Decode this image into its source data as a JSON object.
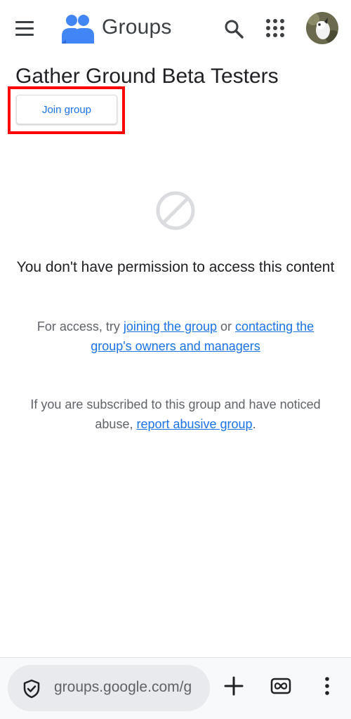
{
  "header": {
    "app_name": "Groups",
    "menu_icon": "hamburger-menu-icon",
    "logo_icon": "google-groups-logo",
    "search_icon": "search-icon",
    "apps_icon": "apps-grid-icon",
    "avatar": "user-avatar"
  },
  "group": {
    "name": "Gather Ground Beta Testers",
    "join_label": "Join group"
  },
  "message": {
    "icon": "blocked-icon",
    "title": "You don't have permission to access this content",
    "access_prefix": "For access, try ",
    "join_link": "joining the group",
    "access_middle": " or ",
    "contact_link": "contacting the group's owners and managers",
    "abuse_prefix": "If you are subscribed to this group and have noticed abuse, ",
    "report_link": "report abusive group",
    "abuse_suffix": "."
  },
  "browser": {
    "url": "groups.google.com/g",
    "security_icon": "shield-check-icon",
    "new_tab_icon": "plus-icon",
    "tabs_icon": "tab-switcher-icon",
    "menu_icon": "more-vert-icon"
  },
  "colors": {
    "accent": "#1a73e8",
    "highlight": "#ff0000",
    "text": "#202124",
    "muted": "#5f6368"
  }
}
